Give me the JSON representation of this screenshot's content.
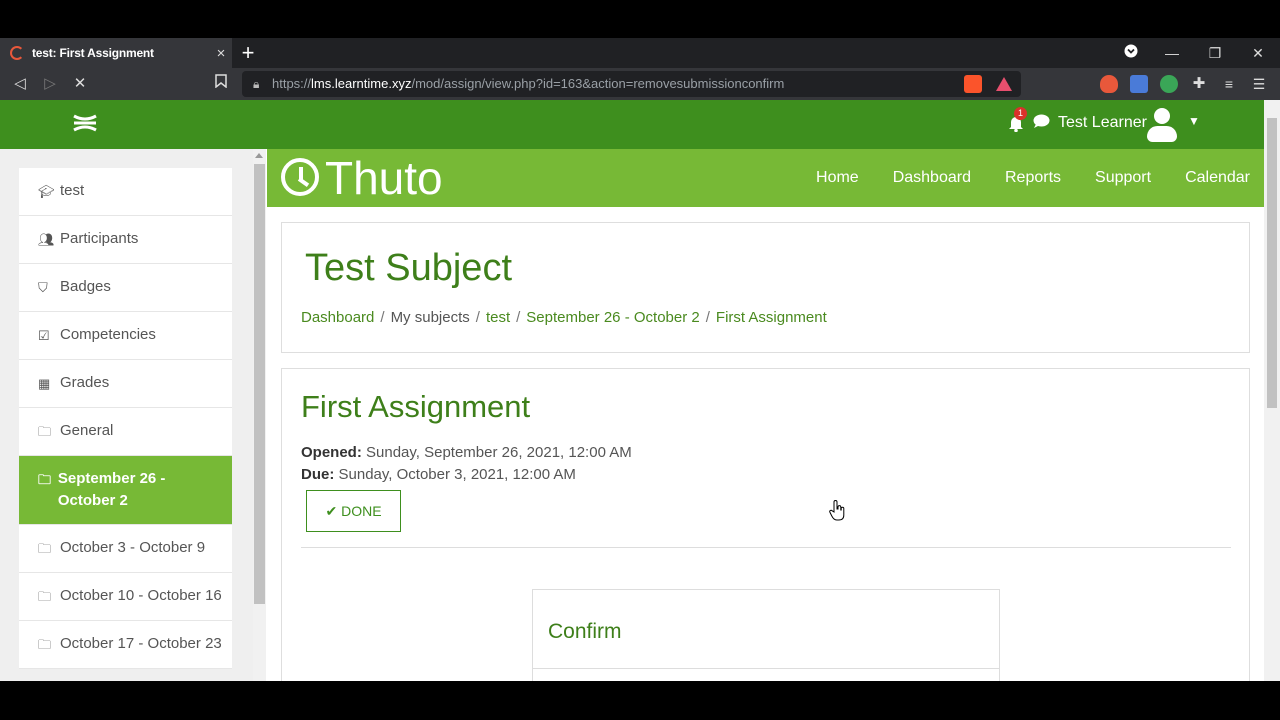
{
  "browser": {
    "tab_title": "test: First Assignment",
    "tab_close": "×",
    "new_tab": "+",
    "url_prefix": "https://",
    "url_host": "lms.learntime.xyz",
    "url_path": "/mod/assign/view.php?id=163&action=removesubmissionconfirm"
  },
  "topbar": {
    "notification_count": "1",
    "user_name": "Test Learner"
  },
  "brand": {
    "logo_text": "Thuto",
    "nav": [
      "Home",
      "Dashboard",
      "Reports",
      "Support",
      "Calendar"
    ]
  },
  "sidebar": {
    "items": [
      {
        "label": "test",
        "icon": "graduation-cap-icon"
      },
      {
        "label": "Participants",
        "icon": "users-icon"
      },
      {
        "label": "Badges",
        "icon": "shield-icon"
      },
      {
        "label": "Competencies",
        "icon": "checkbox-icon"
      },
      {
        "label": "Grades",
        "icon": "table-icon"
      },
      {
        "label": "General",
        "icon": "folder-icon"
      },
      {
        "label": "September 26 - October 2",
        "icon": "folder-icon",
        "active": true
      },
      {
        "label": "October 3 - October 9",
        "icon": "folder-icon"
      },
      {
        "label": "October 10 - October 16",
        "icon": "folder-icon"
      },
      {
        "label": "October 17 - October 23",
        "icon": "folder-icon"
      }
    ]
  },
  "header": {
    "course_title": "Test Subject",
    "breadcrumb": [
      "Dashboard",
      "My subjects",
      "test",
      "September 26 - October 2",
      "First Assignment"
    ]
  },
  "assignment": {
    "title": "First Assignment",
    "opened_label": "Opened:",
    "opened_value": "Sunday, September 26, 2021, 12:00 AM",
    "due_label": "Due:",
    "due_value": "Sunday, October 3, 2021, 12:00 AM",
    "done_label": "DONE"
  },
  "confirm": {
    "title": "Confirm"
  },
  "colors": {
    "topbar": "#3e8f1e",
    "brandbar": "#77b936",
    "heading": "#3e7f1a"
  }
}
